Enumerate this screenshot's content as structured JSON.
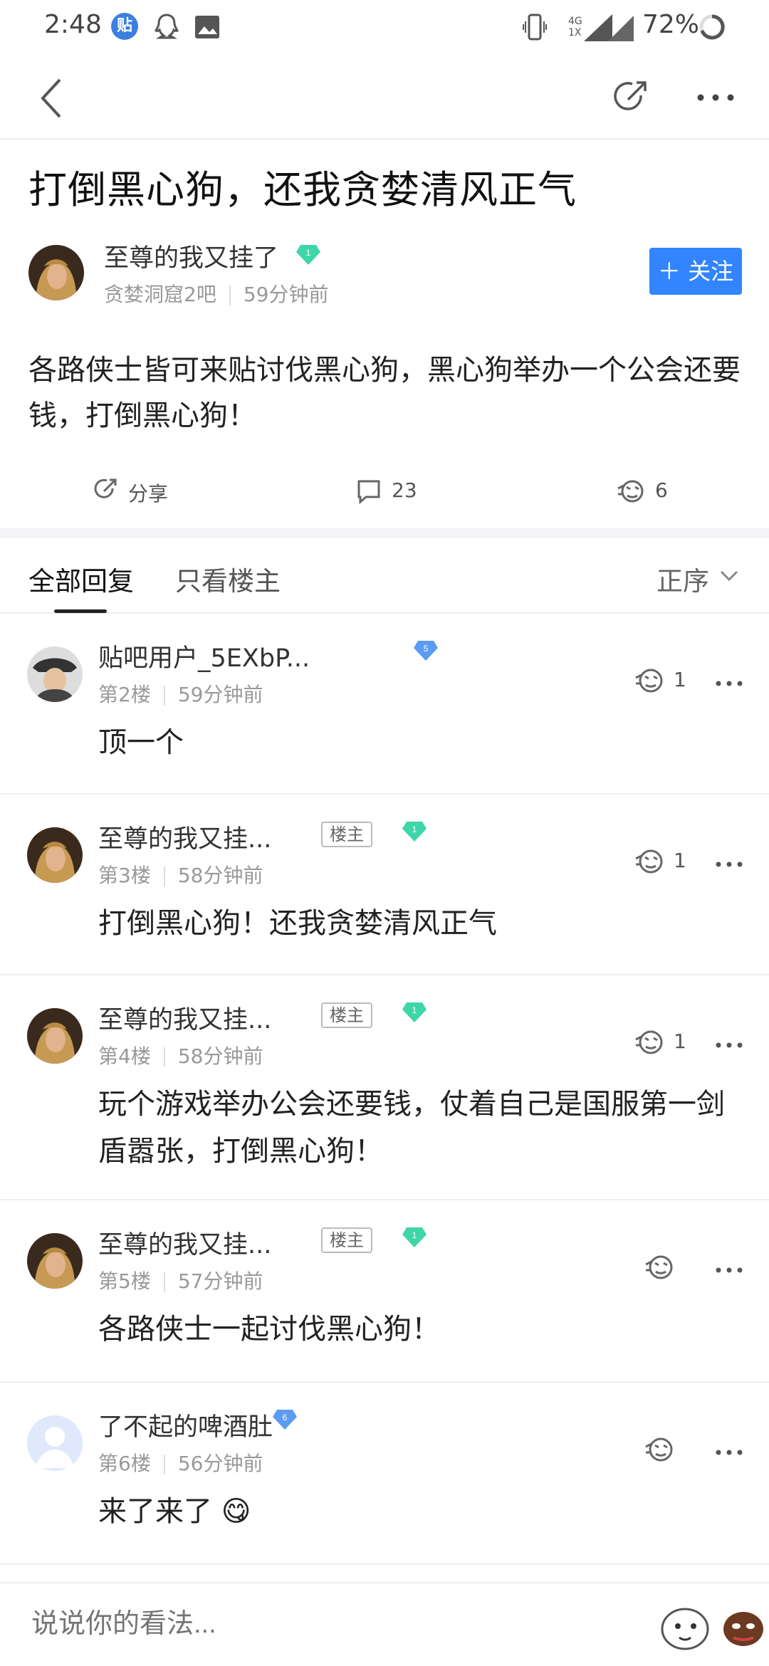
{
  "status_bar": {
    "time": "2:48",
    "tieba_badge": "贴",
    "network_label": "4G",
    "network_sub": "1X",
    "battery_percent": "72%"
  },
  "post": {
    "title": "打倒黑心狗，还我贪婪清风正气",
    "author": "至尊的我又挂了",
    "author_level": "1",
    "forum": "贪婪洞窟2吧",
    "time": "59分钟前",
    "follow_label": "关注",
    "content": "各路侠士皆可来贴讨伐黑心狗，黑心狗举办一个公会还要钱，打倒黑心狗！",
    "share_label": "分享",
    "comment_count": "23",
    "like_count": "6"
  },
  "tabs": {
    "all": "全部回复",
    "owner_only": "只看楼主",
    "sort": "正序"
  },
  "replies": [
    {
      "name": "贴吧用户_5EXbP...",
      "level": "5",
      "floor": "第2楼",
      "time": "59分钟前",
      "content": "顶一个",
      "likes": "1",
      "is_owner": false
    },
    {
      "name": "至尊的我又挂...",
      "level": "1",
      "floor": "第3楼",
      "time": "58分钟前",
      "content": "打倒黑心狗！还我贪婪清风正气",
      "likes": "1",
      "is_owner": true
    },
    {
      "name": "至尊的我又挂...",
      "level": "1",
      "floor": "第4楼",
      "time": "58分钟前",
      "content": "玩个游戏举办公会还要钱，仗着自己是国服第一剑盾嚣张，打倒黑心狗！",
      "likes": "1",
      "is_owner": true
    },
    {
      "name": "至尊的我又挂...",
      "level": "1",
      "floor": "第5楼",
      "time": "57分钟前",
      "content": "各路侠士一起讨伐黑心狗！",
      "likes": "",
      "is_owner": true
    },
    {
      "name": "了不起的啤酒肚",
      "level": "6",
      "floor": "第6楼",
      "time": "56分钟前",
      "content": "来了来了 😋",
      "likes": "",
      "is_owner": false
    }
  ],
  "owner_badge": "楼主",
  "input": {
    "placeholder": "说说你的看法..."
  },
  "colors": {
    "accent": "#3385ff",
    "gem_green": "#3ed6a8",
    "gem_blue": "#5b9cf2"
  }
}
